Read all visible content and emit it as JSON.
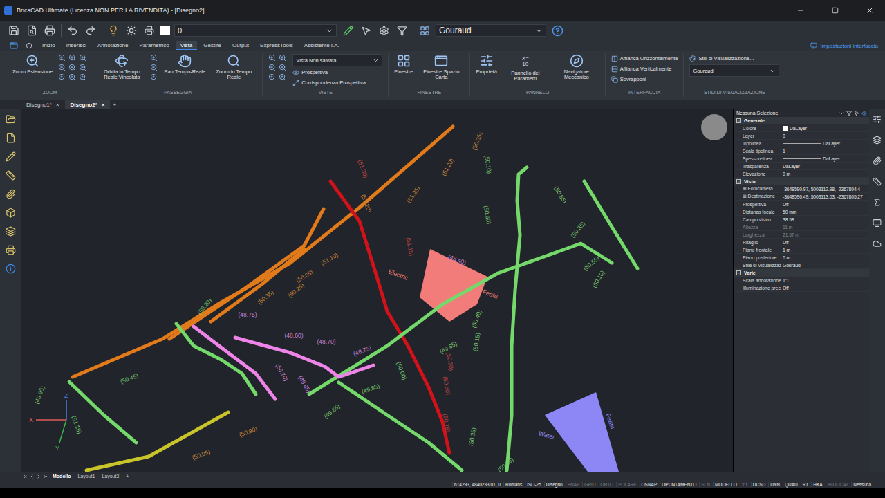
{
  "window": {
    "title": "BricsCAD Ultimate (Licenza NON PER LA RIVENDITA) - [Disegno2]"
  },
  "quick_access": {
    "layer": "0",
    "visual_style": "Gouraud"
  },
  "ribbon_tabs": [
    {
      "label": "Inizio",
      "selected": false
    },
    {
      "label": "Inserisci",
      "selected": false
    },
    {
      "label": "Annotazione",
      "selected": false
    },
    {
      "label": "Parametrico",
      "selected": false
    },
    {
      "label": "Vista",
      "selected": true
    },
    {
      "label": "Gestire",
      "selected": false
    },
    {
      "label": "Output",
      "selected": false
    },
    {
      "label": "ExpressTools",
      "selected": false
    },
    {
      "label": "Assistente I.A.",
      "selected": false
    }
  ],
  "interface_settings": "Impostazioni interfaccia",
  "ribbon_groups": [
    {
      "title": "ZOOM",
      "items": [
        {
          "kind": "large",
          "label": "Zoom Estensione"
        },
        {
          "kind": "icon-grid"
        }
      ]
    },
    {
      "title": "PASSEGGIA",
      "items": [
        {
          "kind": "large",
          "label": "Orbita in Tempo Reale Vincolata"
        },
        {
          "kind": "icon-column"
        },
        {
          "kind": "large",
          "label": "Pan Tempo-Reale"
        },
        {
          "kind": "large",
          "label": "Zoom in Tempo Reale"
        }
      ]
    },
    {
      "title": "VISTE",
      "items": [
        {
          "kind": "icon-pairs"
        },
        {
          "kind": "select",
          "label": "Vista Non salvata"
        },
        {
          "kind": "small",
          "label": "Prospettiva"
        },
        {
          "kind": "small",
          "label": "Corrispondenza Prospettiva"
        }
      ]
    },
    {
      "title": "FINESTRE",
      "items": [
        {
          "kind": "large",
          "label": "Finestre"
        },
        {
          "kind": "large",
          "label": "Finestre Spazio Carta"
        }
      ]
    },
    {
      "title": "PANNELLI",
      "items": [
        {
          "kind": "large",
          "label": "Proprietà"
        },
        {
          "kind": "glyph",
          "label": "Pannello dei Parametri",
          "glyph": [
            "X=",
            "10"
          ]
        },
        {
          "kind": "large",
          "label": "Navigatore Meccanico"
        }
      ]
    },
    {
      "title": "INTERFACCIA",
      "items": [
        {
          "kind": "small",
          "label": "Affianca Orizzontalmente"
        },
        {
          "kind": "small",
          "label": "Affianca Verticalmente"
        },
        {
          "kind": "small",
          "label": "Sovrapponi"
        }
      ]
    },
    {
      "title": "STILI DI VISUALIZZAZIONE",
      "items": [
        {
          "kind": "small",
          "label": "Stili di Visualizzazione..."
        },
        {
          "kind": "select",
          "label": "Gouraud"
        }
      ]
    }
  ],
  "doc_tabs": [
    {
      "label": "Disegno1*",
      "selected": false
    },
    {
      "label": "Disegno2*",
      "selected": true
    }
  ],
  "doc_tab_close": "×",
  "new_tab": "+",
  "canvas": {
    "lines": [
      {
        "color": "#e07a1b"
      },
      {
        "color": "#e07a1b"
      },
      {
        "color": "#e07a1b"
      },
      {
        "color": "#d0121b"
      },
      {
        "color": "#74d86a"
      },
      {
        "color": "#74d86a"
      },
      {
        "color": "#74d86a"
      },
      {
        "color": "#74d86a"
      },
      {
        "color": "#74d86a"
      },
      {
        "color": "#74d86a"
      },
      {
        "color": "#c8c42a"
      },
      {
        "color": "#ee84e8"
      },
      {
        "color": "#ee84e8"
      }
    ],
    "features": [
      {
        "color": "#f27c7a",
        "labels": [
          "Electric",
          "Featu"
        ]
      },
      {
        "color": "#8c87f5",
        "labels": [
          "Water",
          "Featu"
        ]
      }
    ],
    "labels": [
      {
        "text": "(50.35)",
        "color": "#c9863a"
      },
      {
        "text": "(50.10)",
        "color": "#78c96e"
      },
      {
        "text": "(51.30)",
        "color": "#c04545"
      },
      {
        "text": "(51.20)",
        "color": "#c9863a"
      },
      {
        "text": "(51.25)",
        "color": "#c9863a"
      },
      {
        "text": "(51.20)",
        "color": "#c9863a"
      },
      {
        "text": "(50.65)",
        "color": "#78c96e"
      },
      {
        "text": "(50.60)",
        "color": "#78c96e"
      },
      {
        "text": "(50.85)",
        "color": "#78c96e"
      },
      {
        "text": "(51.10)",
        "color": "#c9863a"
      },
      {
        "text": "(51.15)",
        "color": "#c04545"
      },
      {
        "text": "(48.40)",
        "color": "#c682d6"
      },
      {
        "text": "(50.55)",
        "color": "#78c96e"
      },
      {
        "text": "(50.10)",
        "color": "#78c96e"
      },
      {
        "text": "(50.65)",
        "color": "#c9863a"
      },
      {
        "text": "(50.25)",
        "color": "#c9863a"
      },
      {
        "text": "(50.35)",
        "color": "#c9863a"
      },
      {
        "text": "(50.40)",
        "color": "#78c96e"
      },
      {
        "text": "(48.75)",
        "color": "#c682d6"
      },
      {
        "text": "(48.60)",
        "color": "#c682d6"
      },
      {
        "text": "(48.70)",
        "color": "#c682d6"
      },
      {
        "text": "(48.75)",
        "color": "#c682d6"
      },
      {
        "text": "(50.15)",
        "color": "#78c96e"
      },
      {
        "text": "(49.65)",
        "color": "#78c96e"
      },
      {
        "text": "(50.20)",
        "color": "#c04545"
      },
      {
        "text": "(50.00)",
        "color": "#78c96e"
      },
      {
        "text": "(50.70)",
        "color": "#c682d6"
      },
      {
        "text": "(49.85)",
        "color": "#c682d6"
      },
      {
        "text": "(50.45)",
        "color": "#78c96e"
      },
      {
        "text": "(50.60)",
        "color": "#c04545"
      },
      {
        "text": "(50.75)",
        "color": "#c04545"
      },
      {
        "text": "(50.90)",
        "color": "#c9863a"
      },
      {
        "text": "(50.05)",
        "color": "#c9863a"
      },
      {
        "text": "(49.65)",
        "color": "#78c96e"
      },
      {
        "text": "(49.85)",
        "color": "#78c96e"
      },
      {
        "text": "(51.15)",
        "color": "#78c96e"
      },
      {
        "text": "(49.95)",
        "color": "#78c96e"
      },
      {
        "text": "(50.35)",
        "color": "#78c96e"
      },
      {
        "text": "(50.05)",
        "color": "#78c96e"
      },
      {
        "text": "(50.20)",
        "color": "#78c96e"
      }
    ],
    "ucs": {
      "x": "X",
      "y": "Y",
      "z": "Z"
    }
  },
  "properties": {
    "selection": "Nessuna Selezione",
    "sections": [
      {
        "title": "Generale",
        "expanded": true,
        "rows": [
          {
            "label": "Colore",
            "value": "DaLayer",
            "kind": "swatch",
            "disabled": false
          },
          {
            "label": "Layer",
            "value": "0",
            "kind": "text",
            "disabled": false
          },
          {
            "label": "Tipolinea",
            "value": "DaLayer",
            "kind": "line",
            "disabled": false
          },
          {
            "label": "Scala tipolinea",
            "value": "1",
            "kind": "text",
            "disabled": false
          },
          {
            "label": "Spessorelinea",
            "value": "DaLayer",
            "kind": "line",
            "disabled": false
          },
          {
            "label": "Trasparenza",
            "value": "DaLayer",
            "kind": "text",
            "disabled": false
          },
          {
            "label": "Elevazione",
            "value": "0 m",
            "kind": "text",
            "disabled": false
          }
        ]
      },
      {
        "title": "Vista",
        "expanded": true,
        "rows": [
          {
            "label": "Fotocamera",
            "value": "-3648590.97, 5003112.98, -2367804.4",
            "kind": "expandable",
            "disabled": false
          },
          {
            "label": "Destinazione",
            "value": "-3648590.49, 5003113.03, -2367805.27",
            "kind": "expandable",
            "disabled": false
          },
          {
            "label": "Prospettiva",
            "value": "Off",
            "kind": "text",
            "disabled": false
          },
          {
            "label": "Distanza focale",
            "value": "50 mm",
            "kind": "text",
            "disabled": false
          },
          {
            "label": "Campo visivo",
            "value": "38.58",
            "kind": "text",
            "disabled": false
          },
          {
            "label": "Altezza",
            "value": "11 m",
            "kind": "text",
            "disabled": true
          },
          {
            "label": "Larghezza",
            "value": "21.57 m",
            "kind": "text",
            "disabled": true
          },
          {
            "label": "Ritaglio",
            "value": "Off",
            "kind": "text",
            "disabled": false
          },
          {
            "label": "Piano frontale",
            "value": "1 m",
            "kind": "text",
            "disabled": false
          },
          {
            "label": "Piano posteriore",
            "value": "0 m",
            "kind": "text",
            "disabled": false
          },
          {
            "label": "Stile di Visualizzaz",
            "value": "Gouraud",
            "kind": "text",
            "disabled": false
          }
        ]
      },
      {
        "title": "Varie",
        "expanded": true,
        "rows": [
          {
            "label": "Scala annotazione",
            "value": "1:1",
            "kind": "text",
            "disabled": false
          },
          {
            "label": "Illuminazione prec",
            "value": "Off",
            "kind": "text",
            "disabled": false
          }
        ]
      }
    ]
  },
  "layout_tabs": [
    {
      "label": "Modello",
      "selected": true
    },
    {
      "label": "Layout1",
      "selected": false
    },
    {
      "label": "Layout2",
      "selected": false
    }
  ],
  "layout_new": "+",
  "status_bar": {
    "coordinates": "614293, 4840233.01, 0",
    "texts": [
      "Romans",
      "ISO-25",
      "Disegno"
    ],
    "toggles": [
      {
        "label": "SNAP",
        "on": false
      },
      {
        "label": "GRID",
        "on": false
      },
      {
        "label": "ORTO",
        "on": false
      },
      {
        "label": "POLARE",
        "on": false
      },
      {
        "label": "OSNAP",
        "on": true
      },
      {
        "label": "OPUNTAMENTO",
        "on": true
      },
      {
        "label": "SLN",
        "on": false
      },
      {
        "label": "MODELLO",
        "on": true
      },
      {
        "label": "1:1",
        "on": true
      },
      {
        "label": "UCSD",
        "on": true
      },
      {
        "label": "DYN",
        "on": true
      },
      {
        "label": "QUAD",
        "on": true
      },
      {
        "label": "RT",
        "on": true
      },
      {
        "label": "HKA",
        "on": true
      },
      {
        "label": "BLOCCAZ",
        "on": false
      },
      {
        "label": "Nessuna",
        "on": true
      }
    ]
  }
}
